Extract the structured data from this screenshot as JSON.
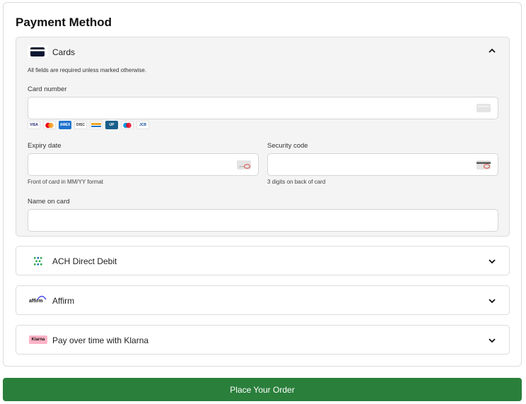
{
  "payment": {
    "title": "Payment Method",
    "cards": {
      "label": "Cards",
      "note": "All fields are required unless marked otherwise.",
      "card_number_label": "Card number",
      "expiry_label": "Expiry date",
      "expiry_hint": "Front of card in MM/YY format",
      "security_label": "Security code",
      "security_hint": "3 digits on back of card",
      "name_label": "Name on card",
      "brands": [
        {
          "name": "VISA",
          "bg": "#ffffff",
          "fg": "#1a1f71"
        },
        {
          "name": "MC",
          "bg": "#ffffff",
          "fg": "#eb001b"
        },
        {
          "name": "AMEX",
          "bg": "#1f72cd",
          "fg": "#ffffff"
        },
        {
          "name": "DISC",
          "bg": "#ffffff",
          "fg": "#333333"
        },
        {
          "name": "SB",
          "bg": "#ffffff",
          "fg": "#f5a623"
        },
        {
          "name": "UP",
          "bg": "#1a5f8a",
          "fg": "#ffffff"
        },
        {
          "name": "MAE",
          "bg": "#ffffff",
          "fg": "#0099df"
        },
        {
          "name": "JCB",
          "bg": "#ffffff",
          "fg": "#0e4c96"
        }
      ]
    },
    "ach": {
      "label": "ACH Direct Debit"
    },
    "affirm": {
      "label": "Affirm",
      "logo": "affirm"
    },
    "klarna": {
      "label": "Pay over time with Klarna",
      "logo": "Klarna"
    }
  },
  "order_button": {
    "label": "Place Your Order"
  },
  "colors": {
    "accent": "#2a7f3b",
    "klarna_pink": "#ffb3c7"
  }
}
